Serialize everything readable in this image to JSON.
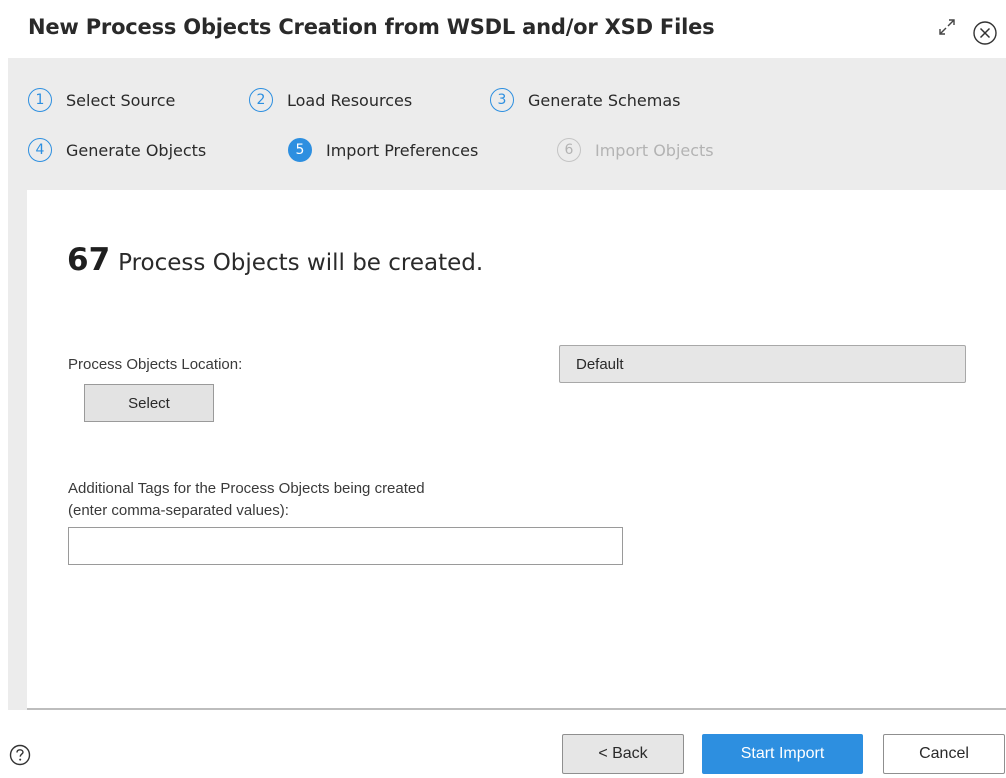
{
  "dialog": {
    "title": "New Process Objects Creation from WSDL and/or XSD Files",
    "expand_icon": "expand-icon",
    "close_icon": "close-circle-icon"
  },
  "steps": [
    {
      "number": "1",
      "label": "Select Source",
      "state": "completed"
    },
    {
      "number": "2",
      "label": "Load Resources",
      "state": "completed"
    },
    {
      "number": "3",
      "label": "Generate Schemas",
      "state": "completed"
    },
    {
      "number": "4",
      "label": "Generate Objects",
      "state": "completed"
    },
    {
      "number": "5",
      "label": "Import Preferences",
      "state": "active"
    },
    {
      "number": "6",
      "label": "Import Objects",
      "state": "disabled"
    }
  ],
  "summary": {
    "count": "67",
    "text": "Process Objects will be created."
  },
  "location": {
    "label": "Process Objects Location:",
    "select_button": "Select",
    "value": "Default"
  },
  "tags": {
    "label_line1": "Additional Tags for the Process Objects being created",
    "label_line2": "(enter comma-separated values):",
    "value": ""
  },
  "footer": {
    "help_icon": "question-circle-icon",
    "back_button": "< Back",
    "start_button": "Start Import",
    "cancel_button": "Cancel"
  },
  "colors": {
    "accent": "#2d8fe0",
    "step_bar_bg": "#ececec",
    "disabled_text": "#b3b3b3"
  }
}
